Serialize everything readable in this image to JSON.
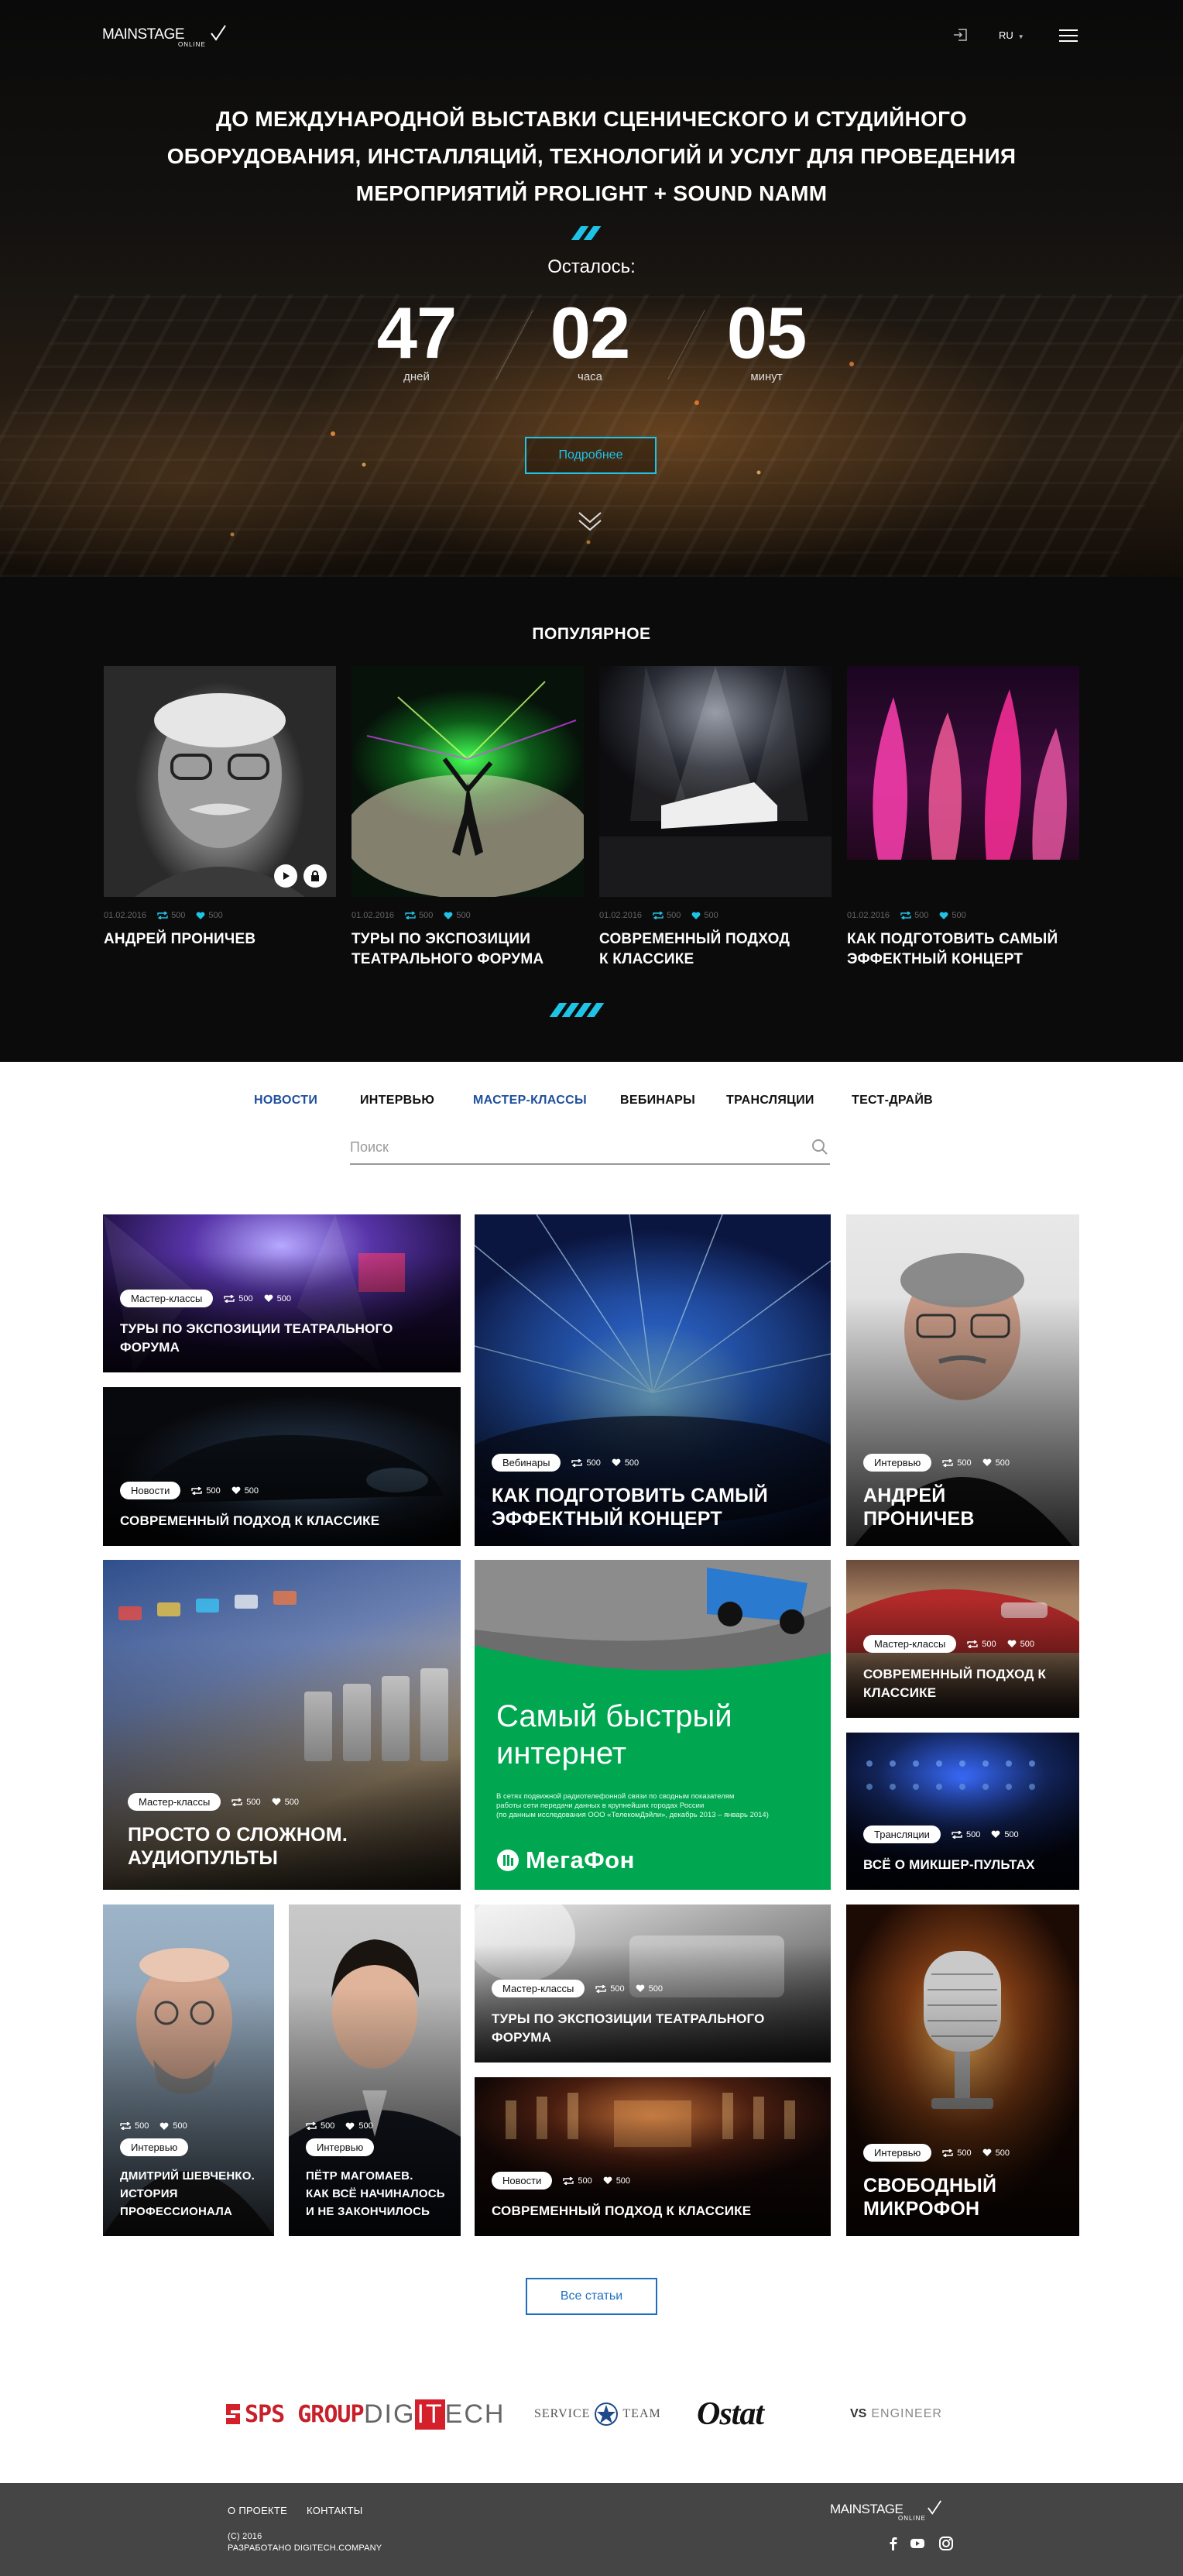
{
  "header": {
    "logo_main": "MAINSTAGE",
    "logo_sub": "ONLINE",
    "login_icon": "login-icon",
    "lang": "RU",
    "menu_icon": "hamburger-icon"
  },
  "hero": {
    "title_lines": [
      "ДО МЕЖДУНАРОДНОЙ ВЫСТАВКИ СЦЕНИЧЕСКОГО И СТУДИЙНОГО",
      "ОБОРУДОВАНИЯ, ИНСТАЛЛЯЦИЙ, ТЕХНОЛОГИЙ И УСЛУГ ДЛЯ ПРОВЕДЕНИЯ",
      "МЕРОПРИЯТИЙ PROLIGHT + SOUND NAMM"
    ],
    "remaining_label": "Осталось:",
    "countdown": [
      {
        "value": "47",
        "unit": "дней"
      },
      {
        "value": "02",
        "unit": "часа"
      },
      {
        "value": "05",
        "unit": "минут"
      }
    ],
    "more_button": "Подробнее",
    "accent_color": "#1ec3e6"
  },
  "popular": {
    "title": "ПОПУЛЯРНОЕ",
    "items": [
      {
        "date": "01.02.2016",
        "reposts": "500",
        "likes": "500",
        "title_lines": [
          "АНДРЕЙ ПРОНИЧЕВ"
        ]
      },
      {
        "date": "01.02.2016",
        "reposts": "500",
        "likes": "500",
        "title_lines": [
          "ТУРЫ ПО ЭКСПОЗИЦИИ",
          "ТЕАТРАЛЬНОГО ФОРУМА"
        ]
      },
      {
        "date": "01.02.2016",
        "reposts": "500",
        "likes": "500",
        "title_lines": [
          "СОВРЕМЕННЫЙ ПОДХОД",
          "К КЛАССИКЕ"
        ]
      },
      {
        "date": "01.02.2016",
        "reposts": "500",
        "likes": "500",
        "title_lines": [
          "КАК ПОДГОТОВИТЬ САМЫЙ",
          "ЭФФЕКТНЫЙ КОНЦЕРТ"
        ]
      }
    ]
  },
  "tabs": [
    {
      "label": "НОВОСТИ",
      "active": true
    },
    {
      "label": "ИНТЕРВЬЮ",
      "active": false
    },
    {
      "label": "МАСТЕР-КЛАССЫ",
      "active": true
    },
    {
      "label": "ВЕБИНАРЫ",
      "active": false
    },
    {
      "label": "ТРАНСЛЯЦИИ",
      "active": false
    },
    {
      "label": "ТЕСТ-ДРАЙВ",
      "active": false
    }
  ],
  "search": {
    "placeholder": "Поиск",
    "value": ""
  },
  "tiles": [
    {
      "badge": "Мастер-классы",
      "reposts": "500",
      "likes": "500",
      "title_lines": [
        "ТУРЫ ПО ЭКСПОЗИЦИИ ТЕАТРАЛЬНОГО",
        "ФОРУМА"
      ]
    },
    {
      "badge": "Новости",
      "reposts": "500",
      "likes": "500",
      "title_lines": [
        "СОВРЕМЕННЫЙ ПОДХОД К КЛАССИКЕ"
      ]
    },
    {
      "badge": "Вебинары",
      "reposts": "500",
      "likes": "500",
      "title_lines": [
        "КАК ПОДГОТОВИТЬ САМЫЙ",
        "ЭФФЕКТНЫЙ КОНЦЕРТ"
      ]
    },
    {
      "badge": "Интервью",
      "reposts": "500",
      "likes": "500",
      "title_lines": [
        "АНДРЕЙ",
        "ПРОНИЧЕВ"
      ]
    },
    {
      "badge": "Мастер-классы",
      "reposts": "500",
      "likes": "500",
      "title_lines": [
        "ПРОСТО О СЛОЖНОМ.",
        "АУДИОПУЛЬТЫ"
      ]
    },
    {
      "badge": "Мастер-классы",
      "reposts": "500",
      "likes": "500",
      "title_lines": [
        "СОВРЕМЕННЫЙ ПОДХОД К",
        "КЛАССИКЕ"
      ]
    },
    {
      "badge": "Трансляции",
      "reposts": "500",
      "likes": "500",
      "title_lines": [
        "ВСЁ О МИКШЕР-ПУЛЬТАХ"
      ]
    },
    {
      "badge": "Интервью",
      "reposts": "500",
      "likes": "500",
      "title_lines": [
        "ДМИТРИЙ ШЕВЧЕНКО.",
        "ИСТОРИЯ",
        "ПРОФЕССИОНАЛА"
      ]
    },
    {
      "badge": "Интервью",
      "reposts": "500",
      "likes": "500",
      "title_lines": [
        "ПЁТР МАГОМАЕВ.",
        "КАК ВСЁ НАЧИНАЛОСЬ",
        "И НЕ ЗАКОНЧИЛОСЬ"
      ]
    },
    {
      "badge": "Мастер-классы",
      "reposts": "500",
      "likes": "500",
      "title_lines": [
        "ТУРЫ ПО ЭКСПОЗИЦИИ ТЕАТРАЛЬНОГО",
        "ФОРУМА"
      ]
    },
    {
      "badge": "Новости",
      "reposts": "500",
      "likes": "500",
      "title_lines": [
        "СОВРЕМЕННЫЙ ПОДХОД К КЛАССИКЕ"
      ]
    },
    {
      "badge": "Интервью",
      "reposts": "500",
      "likes": "500",
      "title_lines": [
        "СВОБОДНЫЙ",
        "МИКРОФОН"
      ]
    }
  ],
  "ad": {
    "headline_lines": [
      "Самый быстрый",
      "интернет"
    ],
    "fine_print_lines": [
      "В сетях подвижной радиотелефонной связи по сводным показателям",
      "работы сети передачи данных в крупнейших городах России",
      "(по данным исследования ООО «ТелекомДэйли», декабрь 2013 – январь 2014)"
    ],
    "brand": "МегаФон",
    "brand_color": "#00a650"
  },
  "all_articles_button": "Все статьи",
  "partners": [
    {
      "name": "SPS GROUP"
    },
    {
      "name_pre": "DIG",
      "name_hl": "IT",
      "name_post": "ECH"
    },
    {
      "name_pre": "SERVICE",
      "name_post": "TEAM"
    },
    {
      "name": "Ostat"
    },
    {
      "name_pre": "VS",
      "name_post": "ENGINEER"
    }
  ],
  "footer": {
    "nav": [
      "О ПРОЕКТЕ",
      "КОНТАКТЫ"
    ],
    "copyright_lines": [
      "(С) 2016",
      "РАЗРАБОТАНО DIGITECH.COMPANY"
    ],
    "logo_main": "MAINSTAGE",
    "logo_sub": "ONLINE",
    "social": [
      "facebook-icon",
      "youtube-icon",
      "instagram-icon"
    ]
  }
}
